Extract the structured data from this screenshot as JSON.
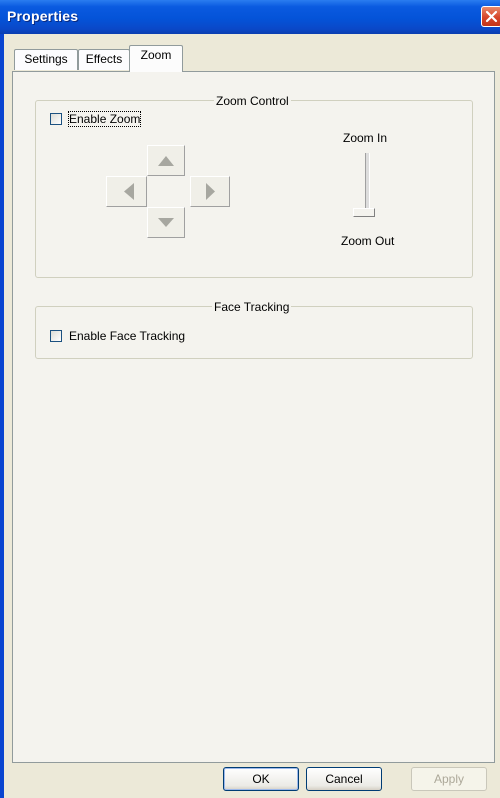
{
  "window": {
    "title": "Properties"
  },
  "tabs": [
    {
      "label": "Settings",
      "active": false
    },
    {
      "label": "Effects",
      "active": false
    },
    {
      "label": "Zoom",
      "active": true
    }
  ],
  "zoom_control": {
    "title": "Zoom Control",
    "enable_label": "Enable Zoom",
    "enable_checked": false,
    "zoom_in_label": "Zoom In",
    "zoom_out_label": "Zoom Out",
    "slider_level": 0
  },
  "face_tracking": {
    "title": "Face Tracking",
    "enable_label": "Enable Face Tracking",
    "enable_checked": false
  },
  "buttons": {
    "ok": "OK",
    "cancel": "Cancel",
    "apply": "Apply"
  },
  "colors": {
    "titlebar": "#0453d8",
    "dialog_bg": "#ece9d8",
    "panel_bg": "#f4f3ee",
    "close": "#d6452a"
  }
}
